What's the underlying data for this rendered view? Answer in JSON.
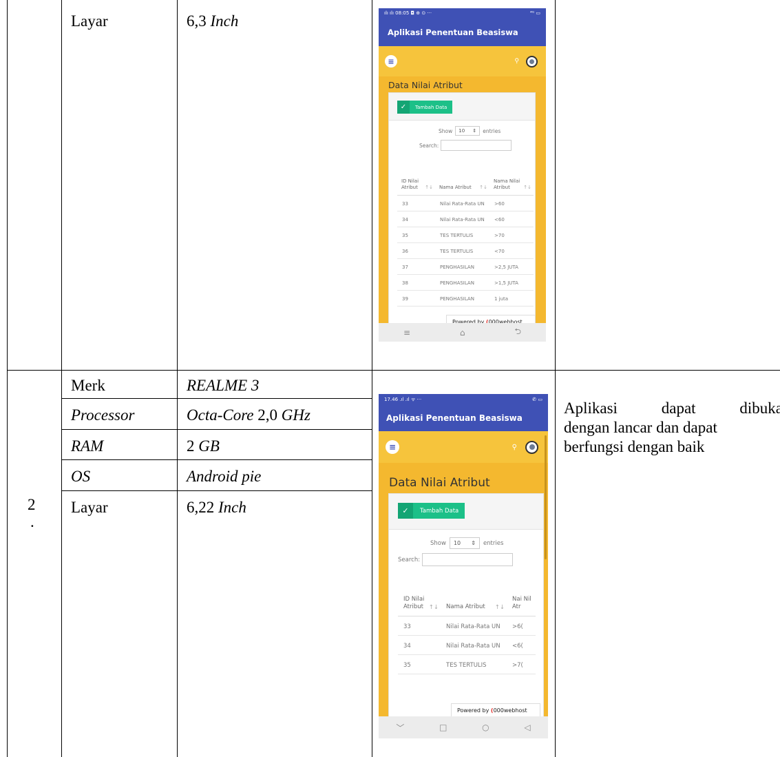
{
  "row1": {
    "spec_label": "Layar",
    "spec_value_num": "6,3",
    "spec_value_unit": "Inch"
  },
  "row2": {
    "number": "2",
    "dot": ".",
    "specs": [
      {
        "label": "Merk",
        "value": "REALME 3"
      },
      {
        "label": "Processor",
        "value_a": "Octa-Core",
        "value_b": " 2,0 ",
        "value_c": "GHz"
      },
      {
        "label": "RAM",
        "value_a": "2 ",
        "value_b": "GB"
      },
      {
        "label": "OS",
        "value": "Android pie"
      },
      {
        "label": "Layar",
        "value_num": "6,22",
        "value_unit": "Inch"
      }
    ],
    "result_line1": [
      "Aplikasi",
      "dapat",
      "dibuka"
    ],
    "result_line2": "dengan lancar dan dapat",
    "result_line3": "berfungsi dengan baik"
  },
  "phone1": {
    "status_left": "ılı ılı 08:05 ◘ ⊕ ⊙ ···",
    "status_right": "⁴ᴳ ▭",
    "app_title": "Aplikasi Penentuan Beasiswa",
    "menu_glyph": "≡",
    "search_glyph": "⚲",
    "page_title": "Data Nilai Atribut",
    "add_button": "Tambah Data",
    "show_label": "Show",
    "show_value": "10",
    "entries_label": "entries",
    "search_label": "Search:",
    "columns": [
      "ID Nilai Atribut",
      "Nama Atribut",
      "Nama Nilai Atribut"
    ],
    "sort_glyph": "↑↓",
    "rows": [
      {
        "id": "33",
        "atribut": "Nilai Rata-Rata UN",
        "nilai": ">60"
      },
      {
        "id": "34",
        "atribut": "Nilai Rata-Rata UN",
        "nilai": "<60"
      },
      {
        "id": "35",
        "atribut": "TES TERTULIS",
        "nilai": ">70"
      },
      {
        "id": "36",
        "atribut": "TES TERTULIS",
        "nilai": "<70"
      },
      {
        "id": "37",
        "atribut": "PENGHASILAN",
        "nilai": ">2,5 JUTA"
      },
      {
        "id": "38",
        "atribut": "PENGHASILAN",
        "nilai": ">1,5 JUTA"
      },
      {
        "id": "39",
        "atribut": "PENGHASILAN",
        "nilai": "1 juta"
      }
    ],
    "powered_by": "Powered by",
    "powered_brand": "000webhost",
    "nav": [
      "≡",
      "⌂",
      "⮌"
    ]
  },
  "phone2": {
    "status_left": "17.46 .ıl .ıl ᯤ ···",
    "status_right": "✆ ▭",
    "app_title": "Aplikasi Penentuan Beasiswa",
    "menu_glyph": "≡",
    "search_glyph": "⚲",
    "page_title": "Data Nilai Atribut",
    "add_button": "Tambah Data",
    "show_label": "Show",
    "show_value": "10",
    "entries_label": "entries",
    "search_label": "Search:",
    "columns": [
      "ID Nilai Atribut",
      "Nama Atribut",
      "Nai Nil Atr"
    ],
    "sort_glyph": "↑↓",
    "rows": [
      {
        "id": "33",
        "atribut": "Nilai Rata-Rata UN",
        "nilai": ">6("
      },
      {
        "id": "34",
        "atribut": "Nilai Rata-Rata UN",
        "nilai": "<6("
      },
      {
        "id": "35",
        "atribut": "TES TERTULIS",
        "nilai": ">7("
      }
    ],
    "powered_by": "Powered by",
    "powered_brand": "000webhost",
    "nav": [
      "﹀",
      "□",
      "○",
      "◁"
    ]
  }
}
